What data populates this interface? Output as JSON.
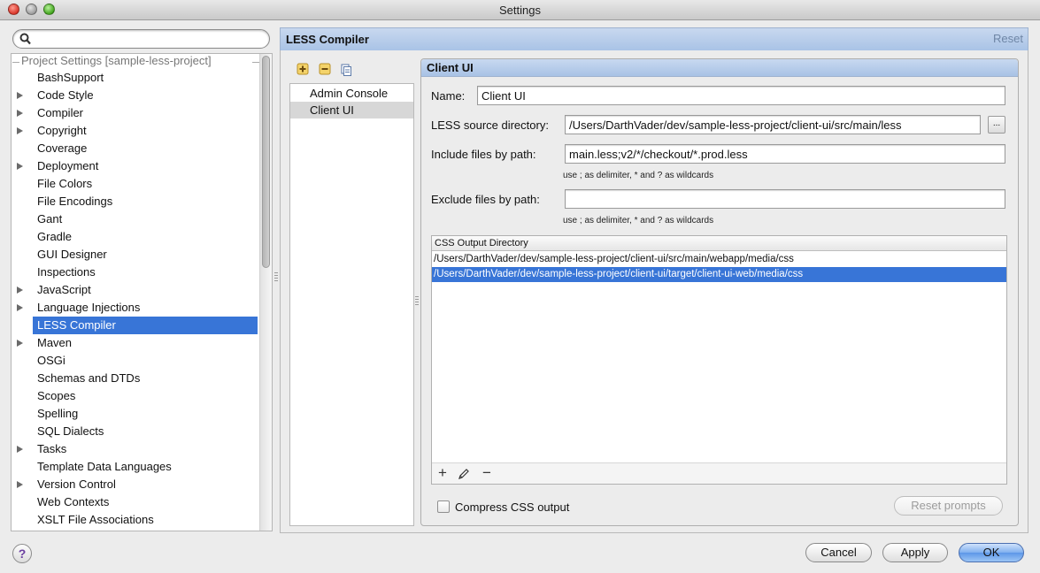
{
  "window": {
    "title": "Settings"
  },
  "search": {
    "placeholder": ""
  },
  "tree": {
    "header": "Project Settings [sample-less-project]",
    "items": [
      {
        "label": "BashSupport",
        "expandable": false
      },
      {
        "label": "Code Style",
        "expandable": true
      },
      {
        "label": "Compiler",
        "expandable": true
      },
      {
        "label": "Copyright",
        "expandable": true
      },
      {
        "label": "Coverage",
        "expandable": false
      },
      {
        "label": "Deployment",
        "expandable": true
      },
      {
        "label": "File Colors",
        "expandable": false
      },
      {
        "label": "File Encodings",
        "expandable": false
      },
      {
        "label": "Gant",
        "expandable": false
      },
      {
        "label": "Gradle",
        "expandable": false
      },
      {
        "label": "GUI Designer",
        "expandable": false
      },
      {
        "label": "Inspections",
        "expandable": false
      },
      {
        "label": "JavaScript",
        "expandable": true
      },
      {
        "label": "Language Injections",
        "expandable": true
      },
      {
        "label": "LESS Compiler",
        "expandable": false,
        "selected": true
      },
      {
        "label": "Maven",
        "expandable": true
      },
      {
        "label": "OSGi",
        "expandable": false
      },
      {
        "label": "Schemas and DTDs",
        "expandable": false
      },
      {
        "label": "Scopes",
        "expandable": false
      },
      {
        "label": "Spelling",
        "expandable": false
      },
      {
        "label": "SQL Dialects",
        "expandable": false
      },
      {
        "label": "Tasks",
        "expandable": true
      },
      {
        "label": "Template Data Languages",
        "expandable": false
      },
      {
        "label": "Version Control",
        "expandable": true
      },
      {
        "label": "Web Contexts",
        "expandable": false
      },
      {
        "label": "XSLT File Associations",
        "expandable": false
      }
    ]
  },
  "panel": {
    "title": "LESS Compiler",
    "reset_label": "Reset"
  },
  "compilers": {
    "items": [
      {
        "label": "Admin Console"
      },
      {
        "label": "Client UI",
        "selected": true
      }
    ]
  },
  "group": {
    "title": "Client UI"
  },
  "form": {
    "name_label": "Name:",
    "name_value": "Client UI",
    "source_label": "LESS source directory:",
    "source_value": "/Users/DarthVader/dev/sample-less-project/client-ui/src/main/less",
    "browse_label": "...",
    "include_label": "Include files by path:",
    "include_value": "main.less;v2/*/checkout/*.prod.less",
    "include_hint": "use ; as delimiter, * and ? as wildcards",
    "exclude_label": "Exclude files by path:",
    "exclude_value": "",
    "exclude_hint": "use ; as delimiter, * and ? as wildcards"
  },
  "output": {
    "header": "CSS Output Directory",
    "rows": [
      "/Users/DarthVader/dev/sample-less-project/client-ui/src/main/webapp/media/css",
      "/Users/DarthVader/dev/sample-less-project/client-ui/target/client-ui-web/media/css"
    ],
    "selected_index": 1
  },
  "options": {
    "compress_label": "Compress CSS output",
    "compress_checked": false,
    "reset_prompts_label": "Reset prompts"
  },
  "footer": {
    "help_label": "?",
    "cancel_label": "Cancel",
    "apply_label": "Apply",
    "ok_label": "OK"
  },
  "colors": {
    "selection": "#3875d7",
    "header_blue": "#a9c3e6"
  }
}
